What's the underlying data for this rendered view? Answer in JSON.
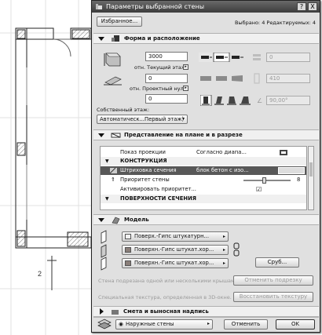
{
  "app": {
    "title": "Параметры выбранной стены",
    "help_label": "?",
    "close_label": "X"
  },
  "header": {
    "favorites_label": "Избранное...",
    "selected_info": "Выбрано: 4 Редактируемых: 4"
  },
  "section_geometry": {
    "title": "Форма и расположение",
    "height_value": "3000",
    "top_link_label": "отн. Текущий этаж",
    "top_offset_value": "0",
    "base_link_label": "отн. Проектный нуль",
    "base_offset_value": "0",
    "home_story_label": "Собственный этаж:",
    "home_story_value": "Автоматическ...Первый этаж)",
    "thickness_value": "0",
    "length_value": "410",
    "angle_value": "90,00°",
    "angle_glyph": "∠"
  },
  "section_plan": {
    "title": "Представление на плане и в разрезе",
    "rows": [
      {
        "label": "Показ проекции",
        "value": "Согласно диапа...",
        "kind": "normal"
      },
      {
        "label": "КОНСТРУКЦИЯ",
        "value": "",
        "kind": "header"
      },
      {
        "label": "Штриховка сечения",
        "value": "блок бетон с изо...",
        "kind": "selected"
      },
      {
        "label": "Приоритет стены",
        "value": "8",
        "kind": "slider"
      },
      {
        "label": "Активировать приоритет...",
        "value": "",
        "kind": "check"
      },
      {
        "label": "ПОВЕРХНОСТИ СЕЧЕНИЯ",
        "value": "",
        "kind": "header"
      }
    ]
  },
  "section_model": {
    "title": "Модель",
    "material1": "Поверх.-Гипс штукатурн...",
    "material2": "Поверхн.-Гипс штукат.хор...",
    "material3": "Поверхн.-Гипс штукат.хор...",
    "log_button": "Сруб...",
    "roof_trim_text": "Стена подрезана одной или несколькими крышами.",
    "roof_trim_button": "Отменить подрезку",
    "texture_text": "Специальная текстура, определенная в 3D-окне.",
    "texture_button": "Восстановить текстуру"
  },
  "section_label": {
    "title": "Смета и выносная надпись"
  },
  "footer": {
    "layer_value": "Наружные стены",
    "cancel_label": "Отменить",
    "ok_label": "OK"
  },
  "canvas": {
    "marker_label": "2"
  }
}
